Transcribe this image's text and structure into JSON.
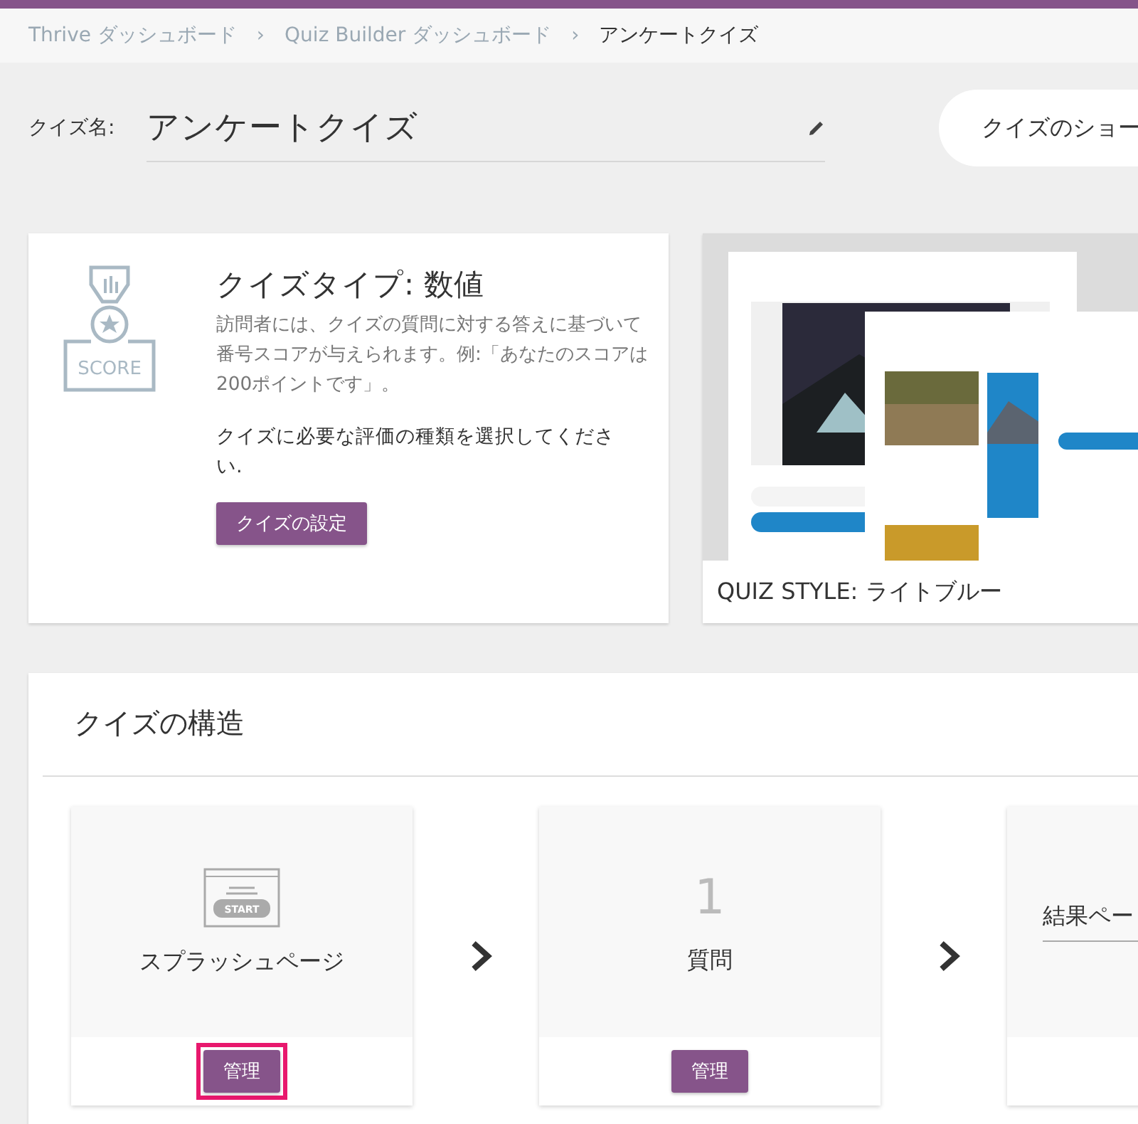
{
  "breadcrumb": [
    {
      "label": "Thrive ダッシュボード",
      "current": false
    },
    {
      "label": "Quiz Builder ダッシュボード",
      "current": false
    },
    {
      "label": "アンケートクイズ",
      "current": true
    }
  ],
  "breadcrumb_separator": "›",
  "quiz_name": {
    "label": "クイズ名:",
    "value": "アンケートクイズ"
  },
  "header_button": "クイズのショー",
  "quiz_type_card": {
    "icon_text": "SCORE",
    "title": "クイズタイプ: 数値",
    "description": "訪問者には、クイズの質問に対する答えに基づいて番号スコアが与えられます。例:「あなたのスコアは200ポイントです」。",
    "instruction": "クイズに必要な評価の種類を選択してください.",
    "button": "クイズの設定"
  },
  "style_card": {
    "caption": "QUIZ STYLE: ライトブルー"
  },
  "structure": {
    "title": "クイズの構造",
    "stages": [
      {
        "kind": "splash",
        "icon_text": "START",
        "label": "スプラッシュページ",
        "button": "管理",
        "highlighted": true
      },
      {
        "kind": "count",
        "count": "1",
        "label": "質問",
        "button": "管理",
        "highlighted": false
      },
      {
        "kind": "field",
        "value": "結果ペー"
      }
    ]
  }
}
